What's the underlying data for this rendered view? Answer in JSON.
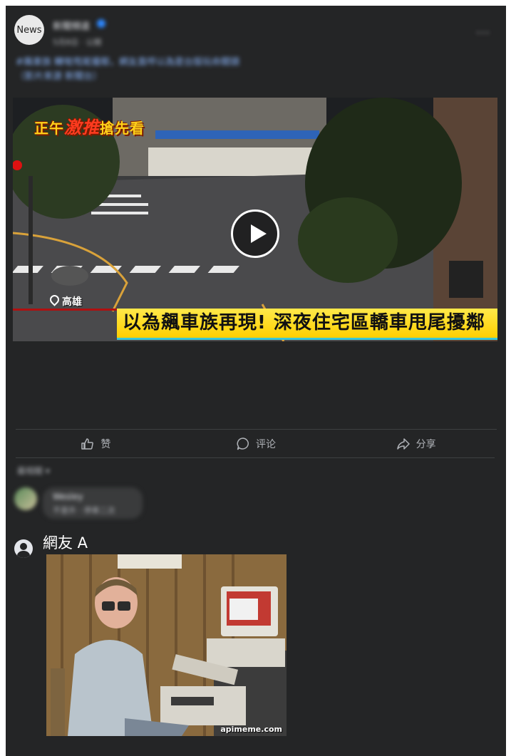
{
  "post": {
    "avatar_label": "News",
    "page_name": "新聞頻道",
    "meta": "5月8日 · 公開",
    "caption_line1": "#飆車族 轉彎甩尾擾鄰，網友直呼以為是台版玩命關頭",
    "caption_line2": "（影片來源 新聞台）",
    "more_label": "···"
  },
  "video": {
    "promo_prefix": "正午",
    "promo_hot": "激推",
    "promo_suffix": "搶先看",
    "location": "高雄",
    "headline": "以為飆車族再現! 深夜住宅區轎車甩尾擾鄰"
  },
  "actions": {
    "like": "赞",
    "comment": "评论",
    "share": "分享"
  },
  "comments": {
    "sort_label": "最相關 ▾",
    "first_name": "Wesley",
    "first_text": "不意外 · 停車二次",
    "netizen_name": "網友 A",
    "meme_watermark": "apimeme.com"
  }
}
